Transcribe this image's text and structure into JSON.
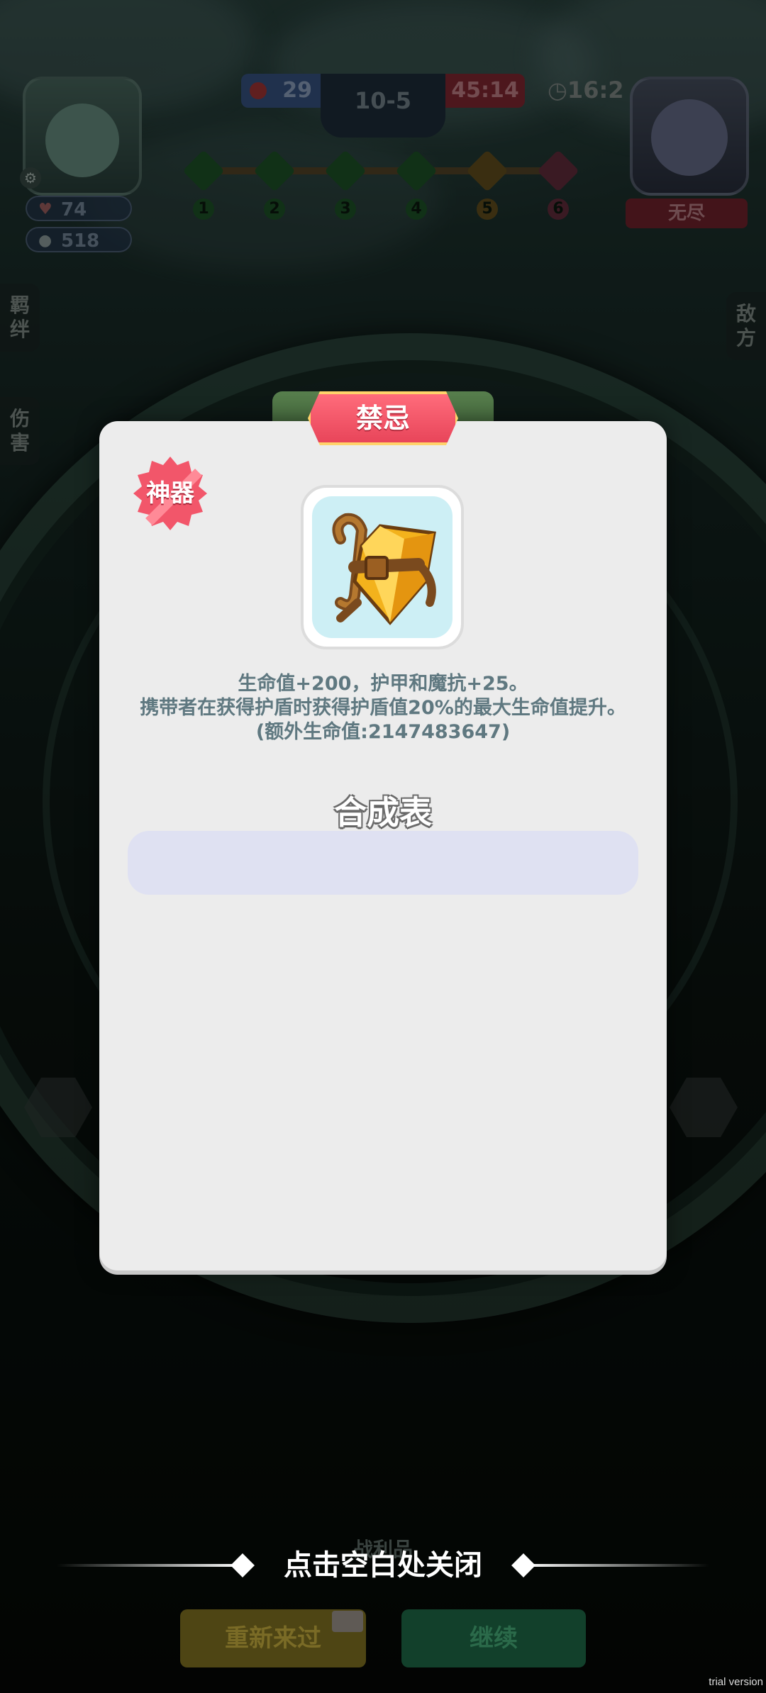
{
  "hud": {
    "hp": "74",
    "gold": "518",
    "blue_score": "29",
    "round": "10-5",
    "red_timer": "45:14",
    "clock": "16:2",
    "stages": [
      "1",
      "2",
      "3",
      "4",
      "5",
      "6"
    ],
    "stage_colors": [
      "#1f5a2b",
      "#1f5a2b",
      "#1f5a2b",
      "#1f5a2b",
      "#6a5520",
      "#6a3040"
    ],
    "opponent_mode": "无尽",
    "left_tabs": [
      "羁绊",
      "伤害"
    ],
    "right_tab": "敌方"
  },
  "modal": {
    "title": "禁忌",
    "badge": "神器",
    "item_icon": "amber-crystal-anchor-icon",
    "desc_lines": [
      "生命值+200，护甲和魔抗+25。",
      "携带者在获得护盾时获得护盾值20%的最大生命值提升。",
      "(额外生命值:2147483647)"
    ],
    "synth_title": "合成表"
  },
  "bottom": {
    "close_hint": "点击空白处关闭",
    "battle_label": "战利品",
    "retry": "重新来过",
    "continue": "继续"
  },
  "watermark": "trial version",
  "colors": {
    "title_red": "#e8455a",
    "banner_border": "#ffd36b",
    "card_bg": "#ececec",
    "desc_text": "#5f7880",
    "icon_bg": "#cdeff5"
  }
}
